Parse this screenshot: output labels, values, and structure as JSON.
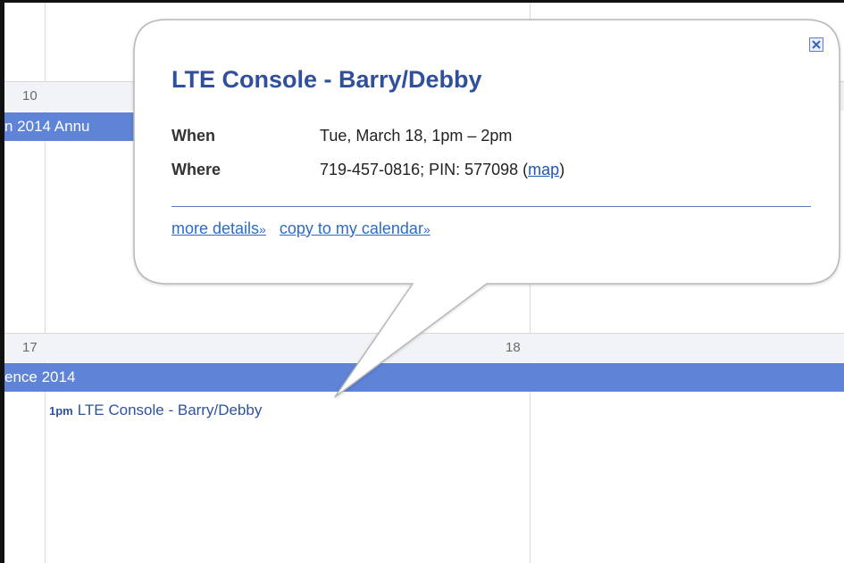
{
  "calendar": {
    "days": [
      {
        "number": "10"
      },
      {
        "number": "17"
      },
      {
        "number": "18"
      }
    ],
    "allday_events": [
      {
        "label": "n 2014 Annu"
      },
      {
        "label": "ence 2014"
      }
    ],
    "timed_event": {
      "time": "1pm",
      "title": "LTE Console - Barry/Debby"
    }
  },
  "popup": {
    "title": "LTE Console - Barry/Debby",
    "when_label": "When",
    "when_value": "Tue, March 18, 1pm – 2pm",
    "where_label": "Where",
    "where_value": "719-457-0816; PIN: 577098",
    "map_link": "map",
    "more_details": "more details",
    "copy_link": "copy to my calendar",
    "link_suffix": "»",
    "close_icon": "close-icon"
  },
  "colors": {
    "allday_bar": "#5f83d6",
    "title": "#30509c",
    "link": "#2f6ac6"
  }
}
